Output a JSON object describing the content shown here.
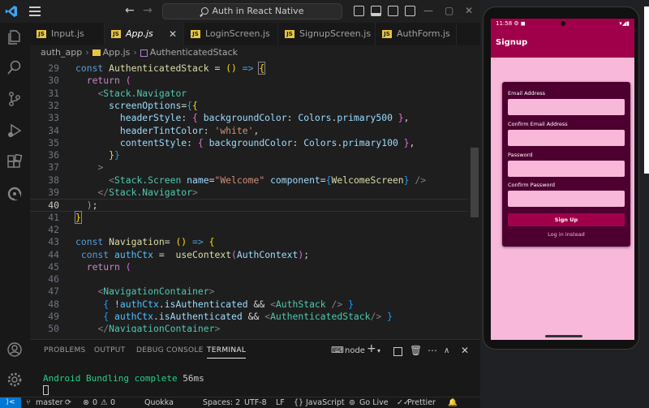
{
  "window": {
    "search_text": "Auth in React Native",
    "nav_back": "←",
    "nav_forward": "→"
  },
  "colors": {
    "accent": "#0078d4",
    "app_primary": "#a0004a",
    "app_card": "#4d0030",
    "app_bg": "#f7b8d9"
  },
  "activity_bar": {
    "icons": [
      "explorer-icon",
      "search-icon",
      "source-control-icon",
      "run-debug-icon",
      "extensions-icon",
      "remote-icon",
      "account-icon",
      "settings-gear-icon"
    ]
  },
  "tabs": [
    {
      "label": "Input.js",
      "active": false
    },
    {
      "label": "App.js",
      "active": true
    },
    {
      "label": "LoginScreen.js",
      "active": false
    },
    {
      "label": "SignupScreen.js",
      "active": false
    },
    {
      "label": "AuthForm.js",
      "active": false
    }
  ],
  "tab_more": "···",
  "tab_close": "✕",
  "breadcrumb": {
    "folder": "auth_app",
    "file": "App.js",
    "symbol": "AuthenticatedStack"
  },
  "editor": {
    "current_line": 40,
    "line_numbers": [
      "29",
      "30",
      "31",
      "32",
      "33",
      "34",
      "35",
      "36",
      "37",
      "38",
      "39",
      "40",
      "41",
      "42",
      "43",
      "44",
      "45",
      "46",
      "47",
      "48",
      "49",
      "50"
    ]
  },
  "panel": {
    "tabs": [
      "PROBLEMS",
      "OUTPUT",
      "DEBUG CONSOLE",
      "TERMINAL"
    ],
    "active_tab": "TERMINAL",
    "terminal_name": "node",
    "output_label": "Android Bundling complete",
    "output_time": "56ms"
  },
  "statusbar": {
    "remote": "⟩<",
    "branch": "master",
    "errors": "0",
    "warnings": "0",
    "quokka": "Quokka",
    "spaces": "Spaces: 2",
    "encoding": "UTF-8",
    "eol": "LF",
    "language": "JavaScript",
    "golive": "Go Live",
    "prettier": "Prettier"
  },
  "android": {
    "time": "11:58",
    "app_title": "Signup",
    "fields": [
      {
        "label": "Email Address"
      },
      {
        "label": "Confirm Email Address"
      },
      {
        "label": "Password"
      },
      {
        "label": "Confirm Password"
      }
    ],
    "signup_button": "Sign Up",
    "login_link": "Log in instead"
  }
}
